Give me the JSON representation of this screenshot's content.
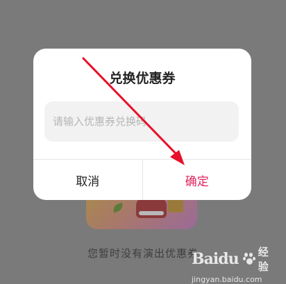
{
  "dialog": {
    "title": "兑换优惠券",
    "input": {
      "value": "",
      "placeholder": "请输入优惠券兑换码"
    },
    "cancel_label": "取消",
    "confirm_label": "确定"
  },
  "background": {
    "empty_text": "您暂时没有演出优惠券"
  },
  "watermark": {
    "brand": "Baidu",
    "label": "经验",
    "url": "jingyan.baidu.com"
  },
  "colors": {
    "overlay": "#7a7a7a",
    "accent": "#e0245e",
    "arrow": "#e8102a"
  }
}
